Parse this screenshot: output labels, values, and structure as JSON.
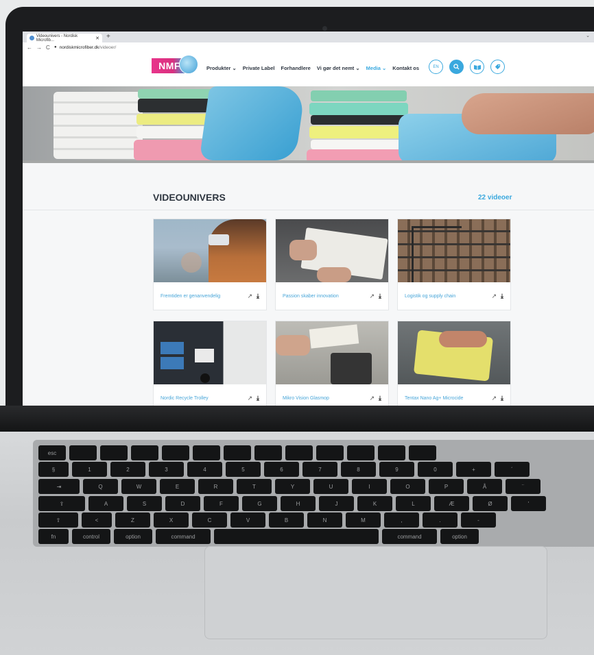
{
  "browser": {
    "tab_title": "Videounivers - Nordisk Microfib...",
    "new_tab": "+",
    "tab_menu": "⌄",
    "url_domain": "nordiskmicrofiber.dk",
    "url_path": "/videoer/"
  },
  "header": {
    "logo": "NMF",
    "menu": [
      {
        "label": "Produkter ⌄"
      },
      {
        "label": "Private Label"
      },
      {
        "label": "Forhandlere"
      },
      {
        "label": "Vi gør det nemt ⌄"
      },
      {
        "label": "Media ⌄"
      },
      {
        "label": "Kontakt os"
      }
    ],
    "lang_button": "EN"
  },
  "section": {
    "title": "VIDEOUNIVERS",
    "count": "22 videoer"
  },
  "videos": [
    {
      "title": "Fremtiden er genanvendelig"
    },
    {
      "title": "Passion skaber innovation"
    },
    {
      "title": "Logistik og supply chain"
    },
    {
      "title": "Nordic Recycle Trolley"
    },
    {
      "title": "Mikro Vision Glasmop"
    },
    {
      "title": "Tentax Nano Ag+ Microcide"
    }
  ],
  "icons": {
    "external": "↗",
    "download": "⤓"
  },
  "keyboard": {
    "row1": [
      "esc",
      "",
      "",
      "",
      "",
      "",
      "",
      "",
      "",
      "",
      "",
      "",
      ""
    ],
    "row2": [
      "§",
      "1",
      "2",
      "3",
      "4",
      "5",
      "6",
      "7",
      "8",
      "9",
      "0",
      "+",
      "´"
    ],
    "row3": [
      "⇥",
      "Q",
      "W",
      "E",
      "R",
      "T",
      "Y",
      "U",
      "I",
      "O",
      "P",
      "Å",
      "¨"
    ],
    "row4": [
      "⇪",
      "A",
      "S",
      "D",
      "F",
      "G",
      "H",
      "J",
      "K",
      "L",
      "Æ",
      "Ø",
      "'"
    ],
    "row5": [
      "⇧",
      "<",
      "Z",
      "X",
      "C",
      "V",
      "B",
      "N",
      "M",
      ",",
      ".",
      "-"
    ],
    "row6": [
      "fn",
      "control",
      "option",
      "command",
      "",
      "command",
      "option"
    ]
  },
  "colors": {
    "accent": "#3aa8de",
    "brand_pink": "#e8358b"
  }
}
